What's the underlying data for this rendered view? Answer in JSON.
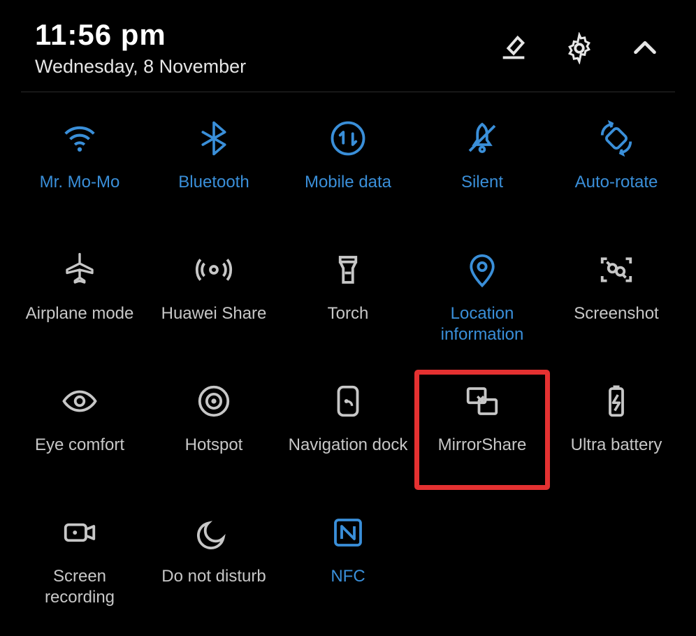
{
  "header": {
    "time": "11:56 pm",
    "date": "Wednesday, 8 November"
  },
  "tiles": {
    "r0c0": "Mr. Mo-Mo",
    "r0c1": "Bluetooth",
    "r0c2": "Mobile data",
    "r0c3": "Silent",
    "r0c4": "Auto-rotate",
    "r1c0": "Airplane mode",
    "r1c1": "Huawei Share",
    "r1c2": "Torch",
    "r1c3": "Location information",
    "r1c4": "Screenshot",
    "r2c0": "Eye comfort",
    "r2c1": "Hotspot",
    "r2c2": "Navigation dock",
    "r2c3": "MirrorShare",
    "r2c4": "Ultra battery",
    "r3c0": "Screen recording",
    "r3c1": "Do not disturb",
    "r3c2": "NFC"
  },
  "colors": {
    "active": "#3a8fd9",
    "inactive": "#c7c7c7",
    "highlight_border": "#e43131"
  }
}
